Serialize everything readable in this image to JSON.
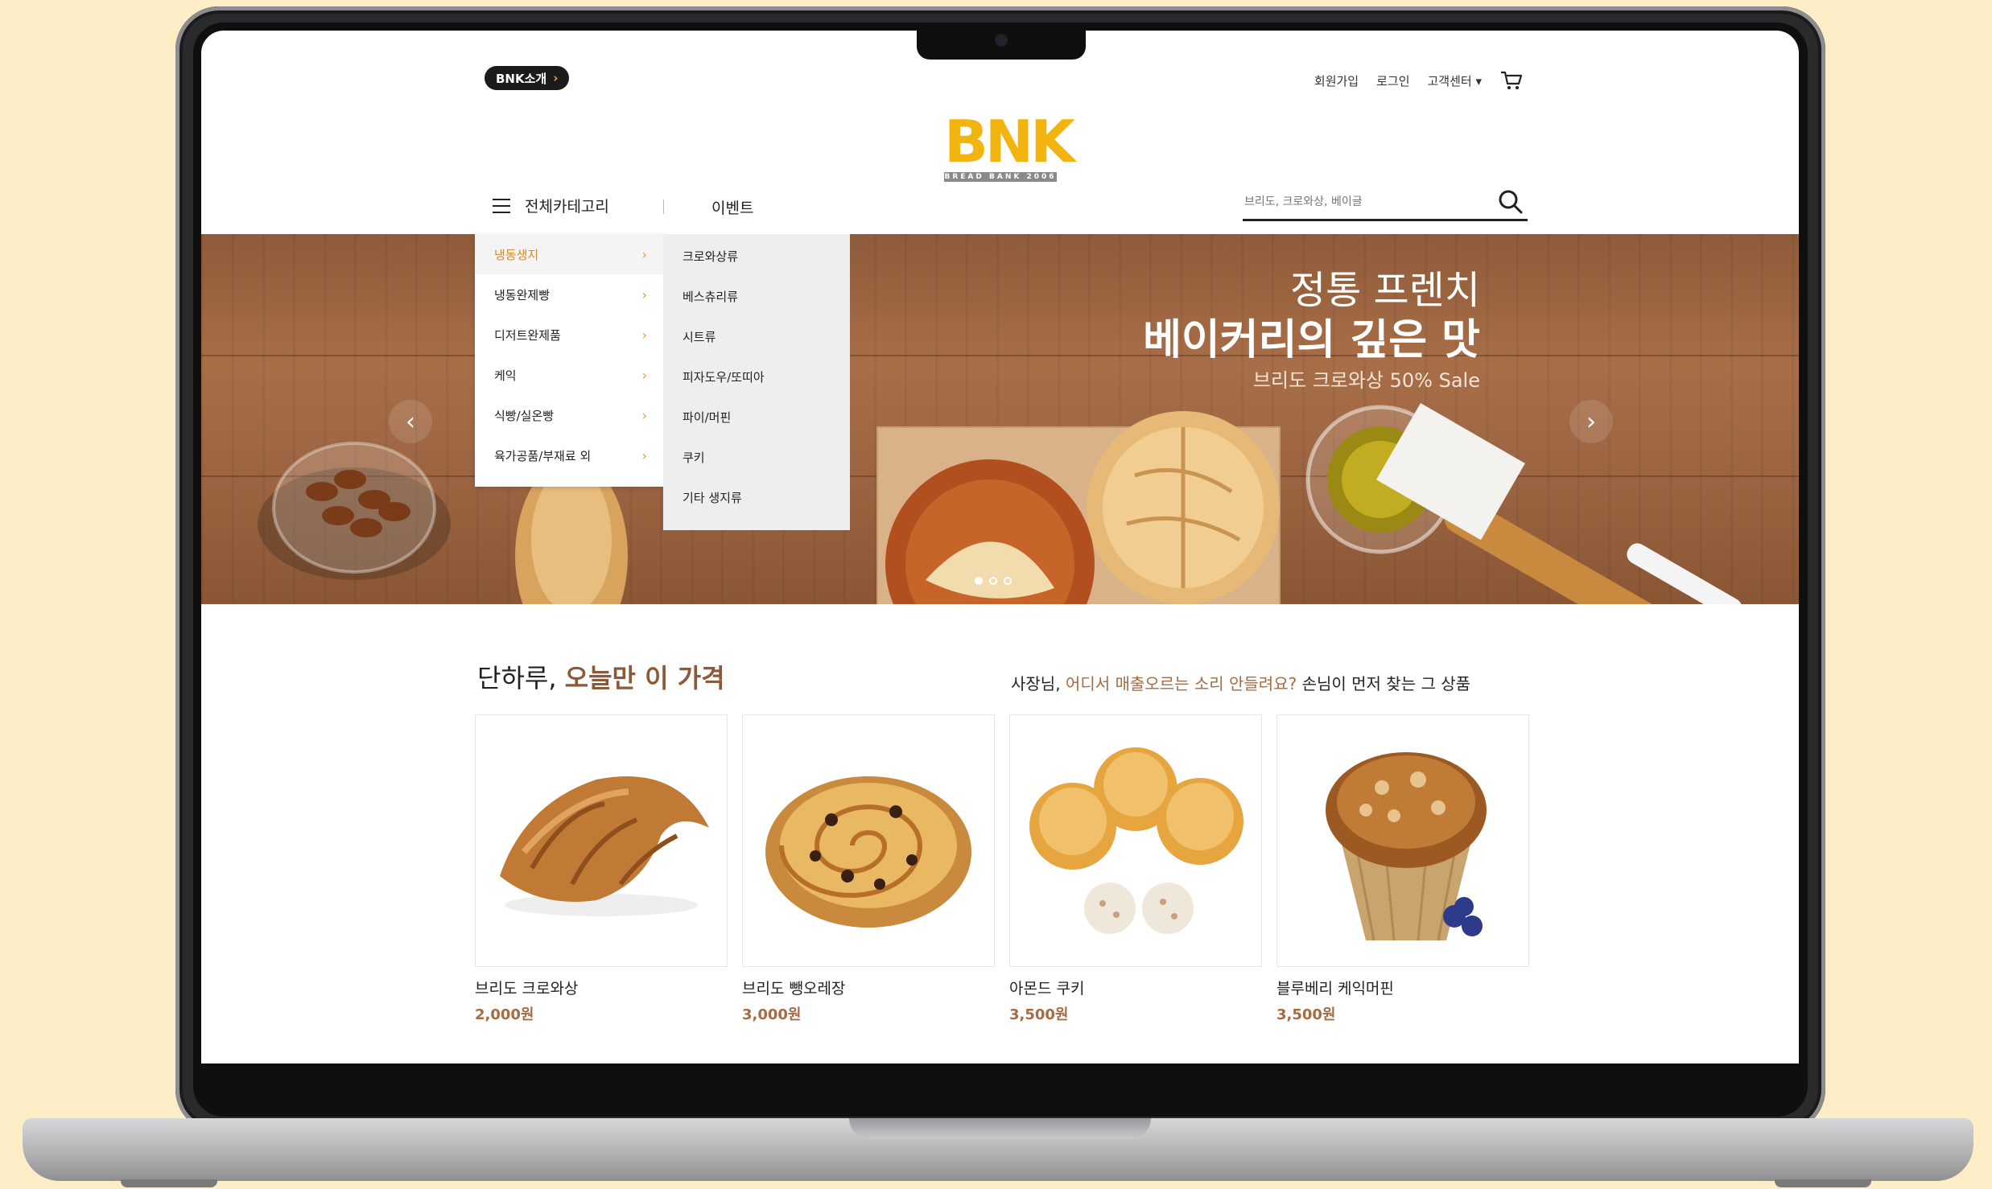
{
  "topbar": {
    "bnk_pill": "BNK소개",
    "links": [
      "회원가입",
      "로그인",
      "고객센터 ▾"
    ]
  },
  "logo": {
    "mark": "BNK",
    "tagline": "BREAD BANK 2006"
  },
  "nav": {
    "category_label": "전체카테고리",
    "event_label": "이벤트",
    "search_placeholder": "브리도, 크로와상, 베이글"
  },
  "category_menu": {
    "items": [
      "냉동생지",
      "냉동완제빵",
      "디저트완제품",
      "케익",
      "식빵/실온빵",
      "육가공품/부재료 외"
    ],
    "active": "냉동생지"
  },
  "submenu": {
    "items": [
      "크로와상류",
      "베스츄리류",
      "시트류",
      "피자도우/또띠아",
      "파이/머핀",
      "쿠키",
      "기타 생지류"
    ]
  },
  "hero": {
    "line1": "정통 프렌치",
    "line2": "베이커리의 깊은 맛",
    "line3": "브리도 크로와상 50% Sale",
    "slide_count": 3,
    "active_slide": 1
  },
  "section": {
    "title_plain": "단하루, ",
    "title_accent": "오늘만 이 가격",
    "sub_prefix": "사장님, ",
    "sub_accent": "어디서 매출오르는 소리 안들려요?",
    "sub_suffix": " 손님이 먼저 찾는 그 상품"
  },
  "products": [
    {
      "name": "브리도 크로와상",
      "price": "2,000원"
    },
    {
      "name": "브리도 뺑오레장",
      "price": "3,000원"
    },
    {
      "name": "아몬드 쿠키",
      "price": "3,500원"
    },
    {
      "name": "블루베리 케익머핀",
      "price": "3,500원"
    }
  ],
  "colors": {
    "background": "#fdeec8",
    "accent": "#a66b42",
    "logo": "#f2b40f",
    "menu_active": "#d38a2a"
  }
}
